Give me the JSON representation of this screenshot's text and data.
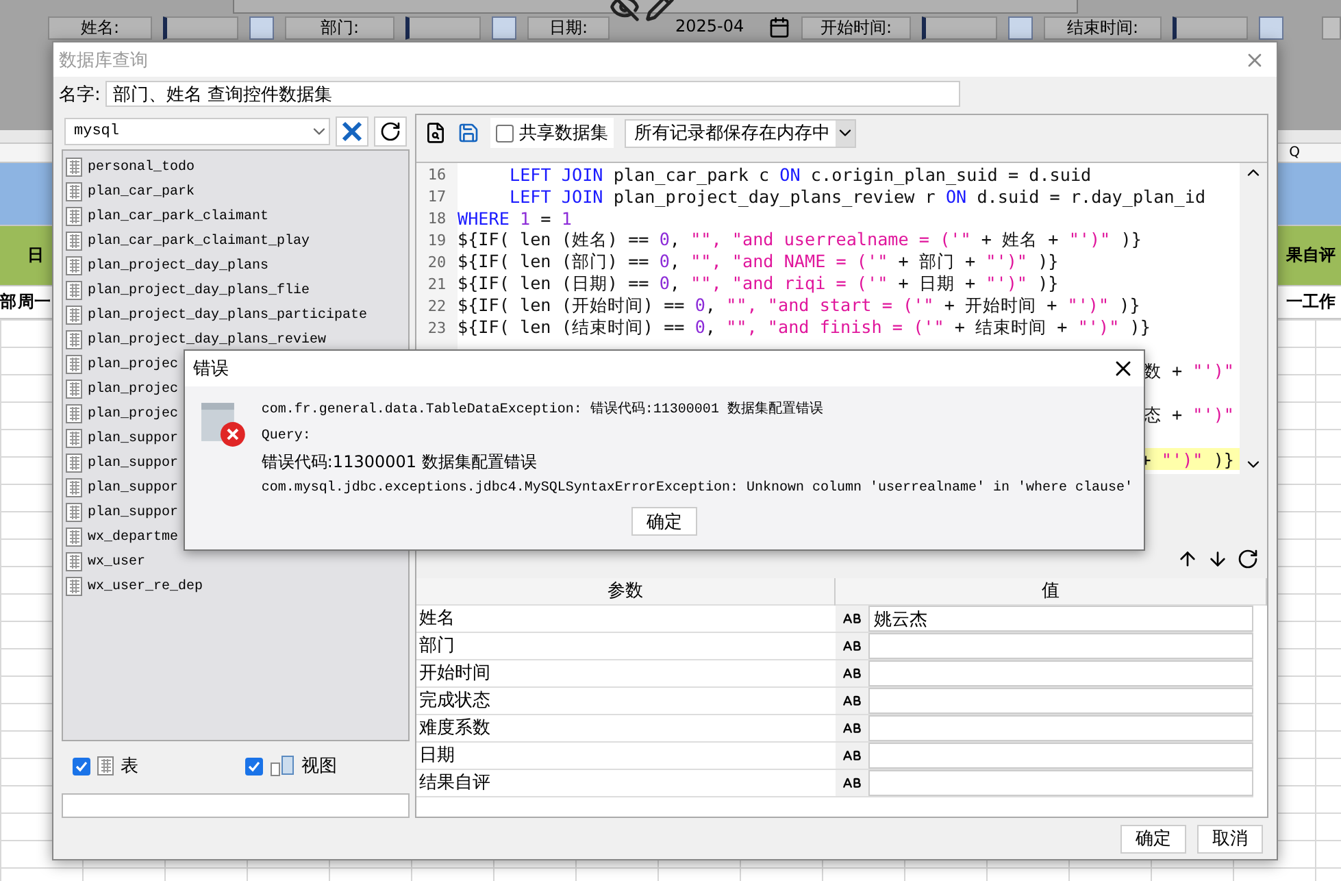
{
  "filters": [
    {
      "label": "姓名:",
      "kind": "combo"
    },
    {
      "label": "部门:",
      "kind": "combo"
    },
    {
      "label": "日期:",
      "kind": "date",
      "value": "2025-04"
    },
    {
      "label": "开始时间:",
      "kind": "combo"
    },
    {
      "label": "结束时间:",
      "kind": "combo"
    }
  ],
  "sheet": {
    "column_header": "Q",
    "band_left": "日",
    "band_right": "果自评",
    "row_left": [
      "部",
      "周一"
    ],
    "row_right": "一工作"
  },
  "dialog": {
    "title": "数据库查询",
    "name_label": "名字:",
    "name_value": "部门、姓名 查询控件数据集",
    "connection": "mysql",
    "tables": [
      "personal_todo",
      "plan_car_park",
      "plan_car_park_claimant",
      "plan_car_park_claimant_play",
      "plan_project_day_plans",
      "plan_project_day_plans_flie",
      "plan_project_day_plans_participate",
      "plan_project_day_plans_review",
      "plan_projec",
      "plan_projec",
      "plan_projec",
      "plan_suppor",
      "plan_suppor",
      "plan_suppor",
      "plan_suppor",
      "wx_departme",
      "wx_user",
      "wx_user_re_dep"
    ],
    "show_tables": {
      "label": "表",
      "checked": true
    },
    "show_views": {
      "label": "视图",
      "checked": true
    },
    "share_dataset": {
      "label": "共享数据集",
      "checked": false
    },
    "storage_mode": "所有记录都保存在内存中",
    "code_lines": [
      {
        "kind": "full",
        "number": "16",
        "indented": true,
        "current": false,
        "segments": [
          {
            "kind": "kw",
            "t": "LEFT JOIN"
          },
          {
            "kind": "plain",
            "t": " plan_car_park c "
          },
          {
            "kind": "kw",
            "t": "ON"
          },
          {
            "kind": "plain",
            "t": " c.origin_plan_suid = d.suid"
          }
        ]
      },
      {
        "kind": "full",
        "number": "17",
        "indented": true,
        "current": false,
        "segments": [
          {
            "kind": "kw",
            "t": "LEFT JOIN"
          },
          {
            "kind": "plain",
            "t": " plan_project_day_plans_review r "
          },
          {
            "kind": "kw",
            "t": "ON"
          },
          {
            "kind": "plain",
            "t": " d.suid = r.day_plan_id"
          }
        ]
      },
      {
        "kind": "full",
        "number": "18",
        "indented": false,
        "current": false,
        "segments": [
          {
            "kind": "kw",
            "t": "WHERE "
          },
          {
            "kind": "num",
            "t": "1"
          },
          {
            "kind": "plain",
            "t": " = "
          },
          {
            "kind": "num",
            "t": "1"
          }
        ]
      },
      {
        "kind": "full",
        "number": "19",
        "indented": false,
        "current": false,
        "segments": [
          {
            "kind": "plain",
            "t": "${IF( len (姓名) == "
          },
          {
            "kind": "num",
            "t": "0"
          },
          {
            "kind": "plain",
            "t": ", "
          },
          {
            "kind": "str",
            "t": "\"\", \"and userrealname = ('\""
          },
          {
            "kind": "plain",
            "t": " + 姓名 + "
          },
          {
            "kind": "str",
            "t": "\"')\""
          },
          {
            "kind": "plain",
            "t": " )}"
          }
        ]
      },
      {
        "kind": "full",
        "number": "20",
        "indented": false,
        "current": false,
        "segments": [
          {
            "kind": "plain",
            "t": "${IF( len (部门) == "
          },
          {
            "kind": "num",
            "t": "0"
          },
          {
            "kind": "plain",
            "t": ", "
          },
          {
            "kind": "str",
            "t": "\"\", \"and NAME = ('\""
          },
          {
            "kind": "plain",
            "t": " + 部门 + "
          },
          {
            "kind": "str",
            "t": "\"')\""
          },
          {
            "kind": "plain",
            "t": " )}"
          }
        ]
      },
      {
        "kind": "full",
        "number": "21",
        "indented": false,
        "current": false,
        "segments": [
          {
            "kind": "plain",
            "t": "${IF( len (日期) == "
          },
          {
            "kind": "num",
            "t": "0"
          },
          {
            "kind": "plain",
            "t": ", "
          },
          {
            "kind": "str",
            "t": "\"\", \"and riqi = ('\""
          },
          {
            "kind": "plain",
            "t": " + 日期 + "
          },
          {
            "kind": "str",
            "t": "\"')\""
          },
          {
            "kind": "plain",
            "t": " )}"
          }
        ]
      },
      {
        "kind": "full",
        "number": "22",
        "indented": false,
        "current": false,
        "segments": [
          {
            "kind": "plain",
            "t": "${IF( len (开始时间) == "
          },
          {
            "kind": "num",
            "t": "0"
          },
          {
            "kind": "plain",
            "t": ", "
          },
          {
            "kind": "str",
            "t": "\"\", \"and start = ('\""
          },
          {
            "kind": "plain",
            "t": " + 开始时间 + "
          },
          {
            "kind": "str",
            "t": "\"')\""
          },
          {
            "kind": "plain",
            "t": " )}"
          }
        ]
      },
      {
        "kind": "full",
        "number": "23",
        "indented": false,
        "current": false,
        "segments": [
          {
            "kind": "plain",
            "t": "${IF( len (结束时间) == "
          },
          {
            "kind": "num",
            "t": "0"
          },
          {
            "kind": "plain",
            "t": ", "
          },
          {
            "kind": "str",
            "t": "\"\", \"and finish = ('\""
          },
          {
            "kind": "plain",
            "t": " + 结束时间 + "
          },
          {
            "kind": "str",
            "t": "\"')\""
          },
          {
            "kind": "plain",
            "t": " )}"
          }
        ]
      },
      {
        "kind": "blank",
        "current": false
      },
      {
        "kind": "tail",
        "current": false,
        "segments": [
          {
            "kind": "plain",
            "t": "数 + "
          },
          {
            "kind": "str",
            "t": "\"')\""
          }
        ]
      },
      {
        "kind": "blank",
        "current": false
      },
      {
        "kind": "tail",
        "current": false,
        "segments": [
          {
            "kind": "plain",
            "t": "态 + "
          },
          {
            "kind": "str",
            "t": "\"')\""
          }
        ]
      },
      {
        "kind": "blank",
        "current": false
      },
      {
        "kind": "tail",
        "current": true,
        "segments": [
          {
            "kind": "plain",
            "t": "+ "
          },
          {
            "kind": "str",
            "t": "\"')\""
          },
          {
            "kind": "plain",
            "t": " )}"
          }
        ]
      }
    ],
    "param_columns": [
      "参数",
      "值"
    ],
    "params": [
      {
        "name": "姓名",
        "value": "姚云杰"
      },
      {
        "name": "部门"
      },
      {
        "name": "开始时间"
      },
      {
        "name": "完成状态"
      },
      {
        "name": "难度系数"
      },
      {
        "name": "日期"
      },
      {
        "name": "结果自评"
      }
    ],
    "buttons": [
      "确定",
      "取消"
    ]
  },
  "error": {
    "title": "错误",
    "lines": [
      {
        "kind": "mono",
        "text": "com.fr.general.data.TableDataException: 错误代码:11300001 数据集配置错误"
      },
      {
        "kind": "mono",
        "text": "Query:"
      },
      {
        "kind": "sans",
        "text": "错误代码:11300001 数据集配置错误"
      },
      {
        "kind": "mono",
        "text": "com.mysql.jdbc.exceptions.jdbc4.MySQLSyntaxErrorException: Unknown column 'userrealname' in 'where clause'"
      }
    ],
    "button": "确定"
  }
}
